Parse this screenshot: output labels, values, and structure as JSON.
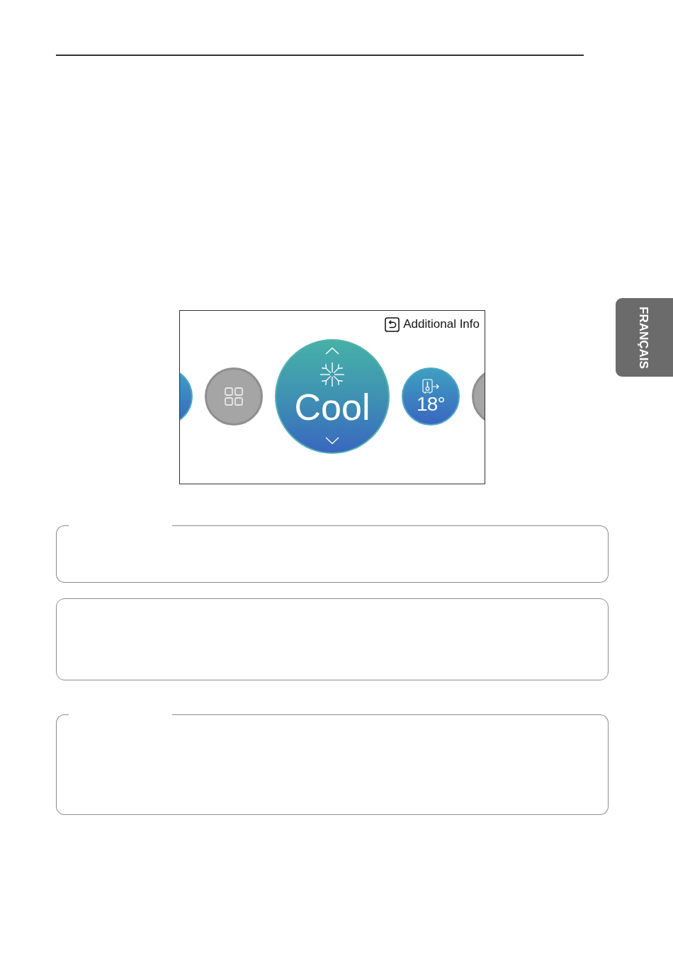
{
  "display": {
    "hint": {
      "label": "Additional Info"
    },
    "carousel": [
      {
        "kind": "plain",
        "selected": false,
        "disabled": false
      },
      {
        "kind": "menu",
        "selected": false,
        "disabled": true
      },
      {
        "kind": "mode",
        "label": "Cool",
        "selected": true,
        "disabled": false
      },
      {
        "kind": "temperature",
        "label": "18°",
        "selected": false,
        "disabled": false
      },
      {
        "kind": "plain",
        "selected": false,
        "disabled": true
      }
    ]
  },
  "language_tab": {
    "label": "FRANÇAIS"
  },
  "note_boxes": [
    {
      "kind": "titled"
    },
    {
      "kind": "plain"
    },
    {
      "kind": "titled"
    }
  ]
}
